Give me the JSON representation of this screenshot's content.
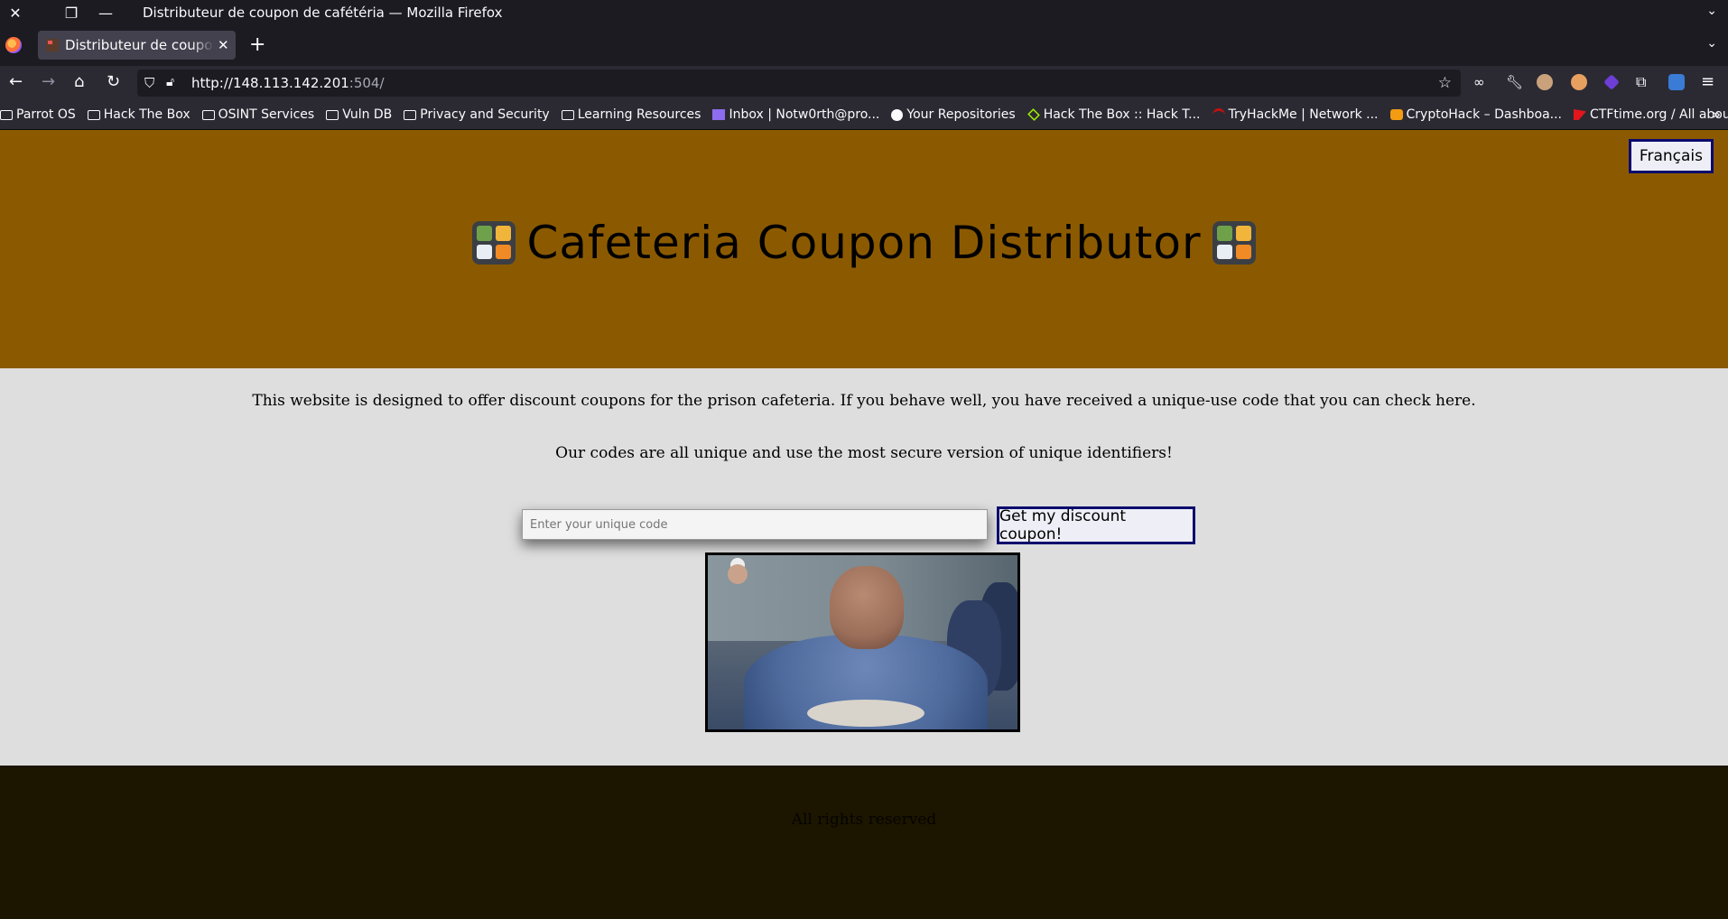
{
  "window": {
    "title": "Distributeur de coupon de cafétéria — Mozilla Firefox"
  },
  "tab": {
    "label": "Distributeur de coupon de cafétéria"
  },
  "urlbar": {
    "host": "http://148.113.142.201",
    "rest": ":504/"
  },
  "bookmarks": [
    {
      "label": "Parrot OS",
      "icon": "folder-icon"
    },
    {
      "label": "Hack The Box",
      "icon": "folder-icon"
    },
    {
      "label": "OSINT Services",
      "icon": "folder-icon"
    },
    {
      "label": "Vuln DB",
      "icon": "folder-icon"
    },
    {
      "label": "Privacy and Security",
      "icon": "folder-icon"
    },
    {
      "label": "Learning Resources",
      "icon": "folder-icon"
    },
    {
      "label": "Inbox | Notw0rth@pro...",
      "icon": "proton-mail-icon"
    },
    {
      "label": "Your Repositories",
      "icon": "github-icon"
    },
    {
      "label": "Hack The Box :: Hack T...",
      "icon": "htb-icon"
    },
    {
      "label": "TryHackMe | Network ...",
      "icon": "tryhackme-icon"
    },
    {
      "label": "CryptoHack – Dashboa...",
      "icon": "cryptohack-icon"
    },
    {
      "label": "CTFtime.org / All abou...",
      "icon": "ctftime-icon"
    }
  ],
  "page": {
    "lang_button": "Français",
    "heading": "Cafeteria Coupon Distributor",
    "heading_emoji": "bento-box-icon",
    "paragraph1": "This website is designed to offer discount coupons for the prison cafeteria. If you behave well, you have received a unique-use code that you can check here.",
    "paragraph2": "Our codes are all unique and use the most secure version of unique identifiers!",
    "input_placeholder": "Enter your unique code",
    "submit_label": "Get my discount coupon!",
    "footer_text": "All rights reserved"
  },
  "colors": {
    "hero_bg": "#8b5a00",
    "body_bg": "#dedede",
    "footer_bg": "#1c1500",
    "button_border": "#0a0a6e"
  }
}
